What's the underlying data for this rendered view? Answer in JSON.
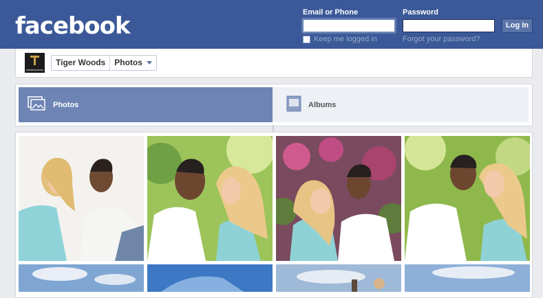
{
  "header": {
    "logo": "facebook",
    "email_label": "Email or Phone",
    "password_label": "Password",
    "email_value": "",
    "password_value": "",
    "keep_logged_in": "Keep me logged in",
    "forgot_password": "Forgot your password?",
    "login_button": "Log In"
  },
  "page": {
    "name": "Tiger Woods",
    "section": "Photos"
  },
  "tabs": [
    {
      "label": "Photos",
      "active": true
    },
    {
      "label": "Albums",
      "active": false
    }
  ],
  "colors": {
    "brand_blue": "#3b5998",
    "active_tab": "#6d84b4",
    "page_bg": "#e9ebee"
  },
  "icons": {
    "photos_tab": "photos-icon",
    "albums_tab": "album-icon"
  }
}
